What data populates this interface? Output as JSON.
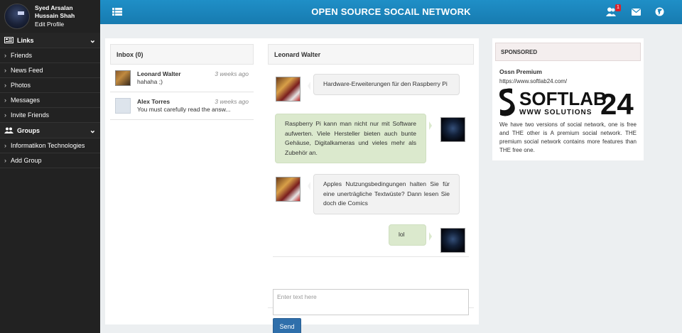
{
  "user": {
    "name": "Syed Arsalan Hussain Shah",
    "name_line1": "Syed Arsalan",
    "name_line2": "Hussain Shah",
    "edit": "Edit Profile"
  },
  "sidebar": {
    "links_header": "Links",
    "links": [
      "Friends",
      "News Feed",
      "Photos",
      "Messages",
      "Invite Friends"
    ],
    "groups_header": "Groups",
    "groups": [
      "Informatikon Technologies",
      "Add Group"
    ]
  },
  "topbar": {
    "title": "OPEN SOURCE SOCAIL NETWORK",
    "notification_count": "1",
    "icons": [
      "menu-icon",
      "friend-requests-icon",
      "messages-icon",
      "globe-icon"
    ]
  },
  "inbox": {
    "title": "Inbox (0)",
    "messages": [
      {
        "name": "Leonard Walter",
        "time": "3 weeks ago",
        "preview": "hahaha ;)"
      },
      {
        "name": "Alex Torres",
        "time": "3 weeks ago",
        "preview": "You must carefully read the answ..."
      }
    ]
  },
  "chat": {
    "title": "Leonard Walter",
    "messages": [
      {
        "from": "in",
        "text": "Hardware-Erweiterungen für den Raspberry Pi"
      },
      {
        "from": "out",
        "text": "Raspberry Pi kann man nicht nur mit Software aufwerten. Viele Hersteller bieten auch bunte Gehäuse, Digitalkameras und vieles mehr als Zubehör an."
      },
      {
        "from": "in",
        "text": "Apples Nutzungsbedingungen halten Sie für eine unerträgliche Textwüste? Dann lesen Sie doch die Comics"
      },
      {
        "from": "out",
        "text": "lol"
      }
    ],
    "input_placeholder": "Enter text here",
    "send_label": "Send"
  },
  "sponsored": {
    "header": "SPONSORED",
    "title": "Ossn Premium",
    "url": "https://www.softlab24.com/",
    "logo_main": "SOFTLAB",
    "logo_num": "24",
    "logo_sub": "WWW SOLUTIONS",
    "description": "We have two versions of social network, one is free and THE other is A premium social network. THE premium social network contains more features than THE free one."
  },
  "colors": {
    "topbar": "#1a87bf",
    "sidebar": "#222222",
    "send_button": "#2f6fab",
    "badge": "#d9232d",
    "outgoing_bubble": "#dbe9cd"
  }
}
